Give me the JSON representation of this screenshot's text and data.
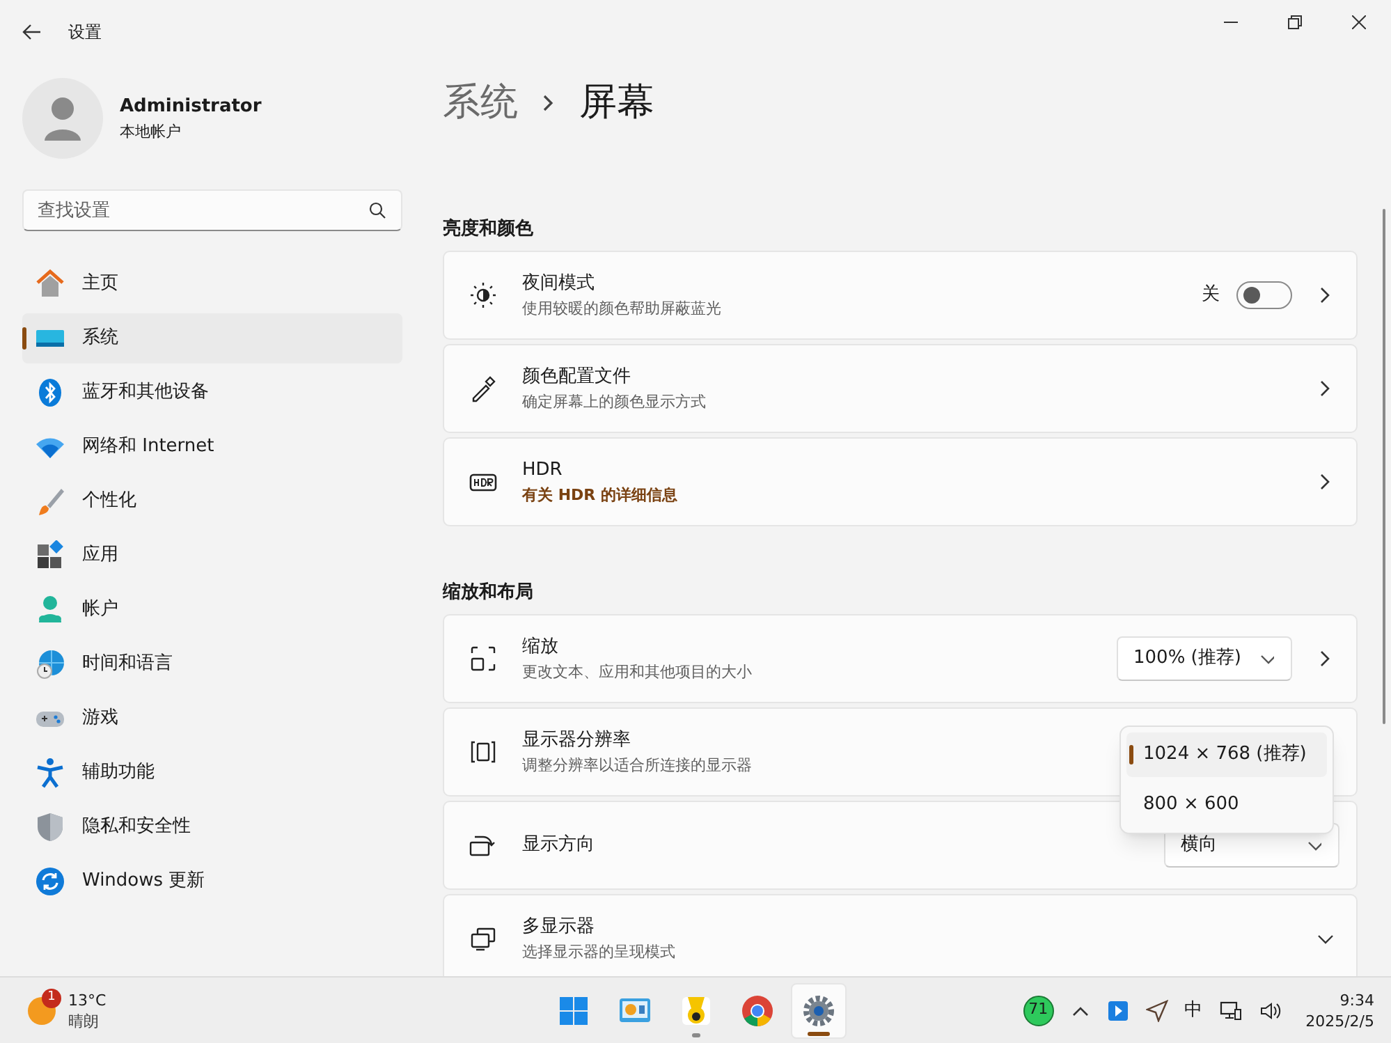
{
  "window": {
    "title": "设置"
  },
  "user": {
    "name": "Administrator",
    "account": "本地帐户"
  },
  "search": {
    "placeholder": "查找设置"
  },
  "nav": [
    {
      "label": "主页",
      "selected": false
    },
    {
      "label": "系统",
      "selected": true
    },
    {
      "label": "蓝牙和其他设备",
      "selected": false
    },
    {
      "label": "网络和 Internet",
      "selected": false
    },
    {
      "label": "个性化",
      "selected": false
    },
    {
      "label": "应用",
      "selected": false
    },
    {
      "label": "帐户",
      "selected": false
    },
    {
      "label": "时间和语言",
      "selected": false
    },
    {
      "label": "游戏",
      "selected": false
    },
    {
      "label": "辅助功能",
      "selected": false
    },
    {
      "label": "隐私和安全性",
      "selected": false
    },
    {
      "label": "Windows 更新",
      "selected": false
    }
  ],
  "breadcrumb": {
    "parent": "系统",
    "current": "屏幕"
  },
  "sections": [
    {
      "title": "亮度和颜色",
      "rows": [
        {
          "kind": "link",
          "title": "夜间模式",
          "subtitle": "使用较暖的颜色帮助屏蔽蓝光",
          "control": {
            "kind": "toggle",
            "label": "关",
            "on": false
          }
        },
        {
          "kind": "link",
          "title": "颜色配置文件",
          "subtitle": "确定屏幕上的颜色显示方式"
        },
        {
          "kind": "link",
          "title": "HDR",
          "link": "有关 HDR 的详细信息"
        }
      ]
    },
    {
      "title": "缩放和布局",
      "rows": [
        {
          "kind": "link",
          "title": "缩放",
          "subtitle": "更改文本、应用和其他项目的大小",
          "control": {
            "kind": "dropdown",
            "value": "100% (推荐)"
          }
        },
        {
          "kind": "plain",
          "title": "显示器分辨率",
          "subtitle": "调整分辨率以适合所连接的显示器",
          "control": {
            "kind": "open-list",
            "options": [
              {
                "label": "1024 × 768 (推荐)",
                "selected": true
              },
              {
                "label": "800 × 600",
                "selected": false
              }
            ]
          }
        },
        {
          "kind": "plain",
          "title": "显示方向",
          "control": {
            "kind": "dropdown",
            "value": "横向"
          }
        },
        {
          "kind": "expander",
          "title": "多显示器",
          "subtitle": "选择显示器的呈现模式"
        }
      ]
    }
  ],
  "taskbar": {
    "weather": {
      "badge": "1",
      "temperature": "13°C",
      "condition": "晴朗"
    },
    "apps": [
      {
        "active": false,
        "running": false
      },
      {
        "active": false,
        "running": false
      },
      {
        "active": false,
        "running": true
      },
      {
        "active": false,
        "running": false
      },
      {
        "active": true,
        "running": true
      }
    ],
    "tray": {
      "badge": "71",
      "ime": "中",
      "time": "9:34",
      "date": "2025/2/5"
    }
  }
}
